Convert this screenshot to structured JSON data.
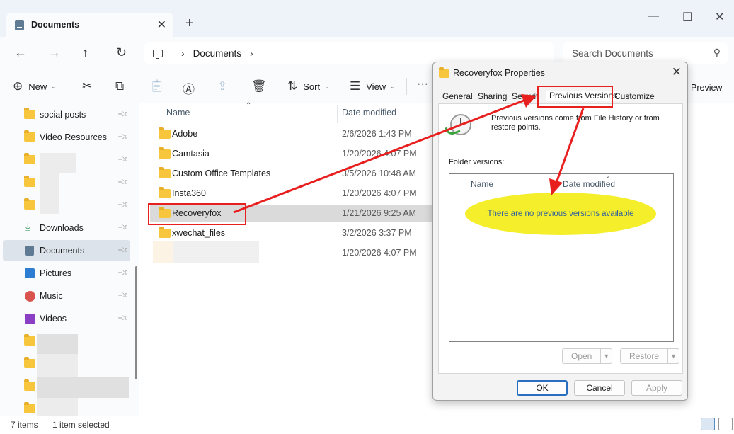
{
  "window": {
    "tab_title": "Documents",
    "tab_close": "✕",
    "new_tab": "+",
    "minimize": "—",
    "maximize": "☐",
    "close": "✕"
  },
  "nav": {
    "back": "←",
    "forward": "→",
    "up": "↑",
    "refresh": "↻",
    "breadcrumb_sep": "›",
    "breadcrumb": "Documents",
    "search_placeholder": "Search Documents"
  },
  "toolbar": {
    "new_label": "New",
    "sort_label": "Sort",
    "view_label": "View",
    "more": "···",
    "preview_label": "Preview"
  },
  "sidebar": {
    "items": [
      {
        "label": "social posts",
        "icon": "folder-icon"
      },
      {
        "label": "Video Resources",
        "icon": "folder-icon"
      },
      {
        "label": "",
        "icon": "folder-icon"
      },
      {
        "label": "",
        "icon": "folder-icon"
      },
      {
        "label": "",
        "icon": "folder-icon"
      },
      {
        "label": "Downloads",
        "icon": "download-icon"
      },
      {
        "label": "Documents",
        "icon": "documents-icon"
      },
      {
        "label": "Pictures",
        "icon": "pictures-icon"
      },
      {
        "label": "Music",
        "icon": "music-icon"
      },
      {
        "label": "Videos",
        "icon": "videos-icon"
      },
      {
        "label": "",
        "icon": "folder-icon"
      },
      {
        "label": "",
        "icon": "folder-icon"
      },
      {
        "label": "",
        "icon": "folder-icon"
      },
      {
        "label": "",
        "icon": "folder-icon"
      }
    ]
  },
  "filelist": {
    "col_name": "Name",
    "col_date": "Date modified",
    "rows": [
      {
        "name": "Adobe",
        "date": "2/6/2026 1:43 PM"
      },
      {
        "name": "Camtasia",
        "date": "1/20/2026 4:07 PM"
      },
      {
        "name": "Custom Office Templates",
        "date": "3/5/2026 10:48 AM"
      },
      {
        "name": "Insta360",
        "date": "1/20/2026 4:07 PM"
      },
      {
        "name": "Recoveryfox",
        "date": "1/21/2026 9:25 AM"
      },
      {
        "name": "xwechat_files",
        "date": "3/2/2026 3:37 PM"
      },
      {
        "name": "",
        "date": "1/20/2026 4:07 PM"
      }
    ]
  },
  "status": {
    "items_count": "7 items",
    "selected": "1 item selected"
  },
  "dialog": {
    "title": "Recoveryfox Properties",
    "close": "✕",
    "tabs": [
      "General",
      "Sharing",
      "Security",
      "Previous Versions",
      "Customize"
    ],
    "info": "Previous versions come from File History or from restore points.",
    "folder_versions_label": "Folder versions:",
    "col_name": "Name",
    "col_date": "Date modified",
    "empty_message": "There are no previous versions available",
    "open_btn": "Open",
    "restore_btn": "Restore",
    "ok_btn": "OK",
    "cancel_btn": "Cancel",
    "apply_btn": "Apply"
  },
  "colors": {
    "accent": "#2a6fbf",
    "annotation_red": "#e81f1f",
    "highlight_yellow": "#f5ee2a",
    "folder_yellow": "#f8c63d"
  }
}
